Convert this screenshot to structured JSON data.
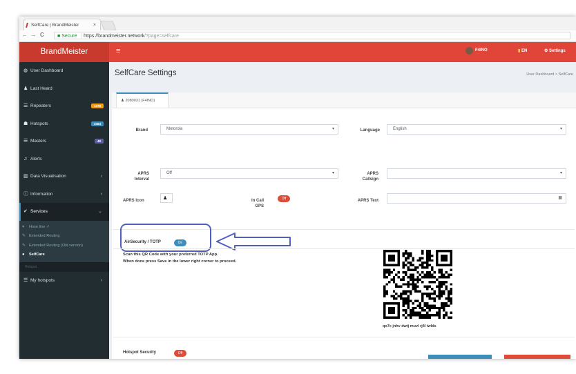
{
  "browser": {
    "tab_title": "SelfCare | BrandMeister",
    "tab_close": "×",
    "back": "←",
    "forward": "→",
    "reload": "C",
    "secure_label": "Secure",
    "url_host": "https://brandmeister.network",
    "url_path": "/?page=selfcare"
  },
  "header": {
    "logo": "BrandMeister",
    "menu_icon": "≡",
    "user": "F4INO",
    "language": "EN",
    "settings": "Settings"
  },
  "sidebar": {
    "items": [
      {
        "label": "User Dashboard",
        "icon": "dashboard-icon"
      },
      {
        "label": "Last Heard",
        "icon": "user-icon"
      },
      {
        "label": "Repeaters",
        "icon": "list-icon",
        "badge": "1278",
        "badge_color": "#f39c12"
      },
      {
        "label": "Hotspots",
        "icon": "hotspot-icon",
        "badge": "3404",
        "badge_color": "#3c8dbc"
      },
      {
        "label": "Masters",
        "icon": "list-icon",
        "badge": "48",
        "badge_color": "#605ca8"
      },
      {
        "label": "Alerts",
        "icon": "bell-icon"
      },
      {
        "label": "Data Visualisation",
        "icon": "chart-icon"
      },
      {
        "label": "Information",
        "icon": "info-icon"
      },
      {
        "label": "Services",
        "icon": "check-icon"
      }
    ],
    "services_sub": [
      {
        "label": "Hose line"
      },
      {
        "label": "Extended Routing"
      },
      {
        "label": "Extended Routing (Old version)"
      },
      {
        "label": "SelfCare"
      }
    ],
    "section_header": "Hotspot",
    "my_hotspots": "My hotspots"
  },
  "content": {
    "title": "SelfCare Settings",
    "breadcrumb": "User Dashboard > SelfCare",
    "tab_label": "2080031 (F4INO)",
    "brand_label": "Brand",
    "brand_value": "Motorola",
    "language_label": "Language",
    "language_value": "English",
    "aprs_interval_label": "APRS\nInterval",
    "aprs_interval_value": "Off",
    "aprs_callsign_label": "APRS\nCallsign",
    "aprs_callsign_value": "",
    "aprs_icon_label": "APRS Icon",
    "in_call_gps_label": "In Call\nGPS",
    "in_call_gps_toggle": "Off",
    "aprs_text_label": "APRS Text",
    "aprs_text_value": "",
    "totp_label": "AirSecurity / TOTP",
    "totp_toggle": "On",
    "instructions_line1": "Scan this QR Code with your preferred TOTP App.",
    "instructions_line2": "When done press Save in the lower right corner to proceed.",
    "totp_secret": "qo7c jnhv dwtj muvl rj4l iwlds",
    "hotspot_security_label": "Hotspot Security",
    "hotspot_security_toggle": "Off"
  },
  "colors": {
    "header_red": "#e1453a",
    "logo_red": "#c83a2e",
    "sidebar_dark": "#222d32",
    "toggle_on": "#3c8dbc",
    "toggle_off": "#dd4b39",
    "annotation_blue": "#4f5fbf"
  }
}
